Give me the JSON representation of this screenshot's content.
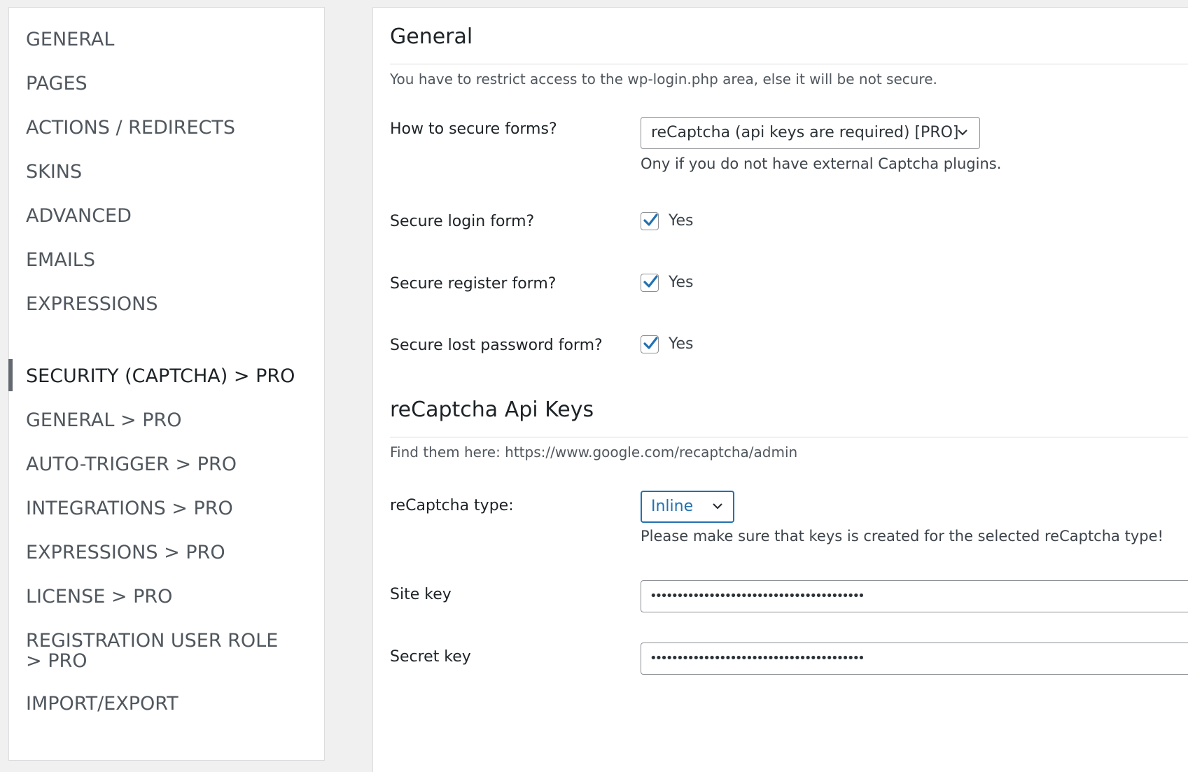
{
  "sidebar": {
    "items": [
      {
        "label": "GENERAL"
      },
      {
        "label": "PAGES"
      },
      {
        "label": "ACTIONS / REDIRECTS"
      },
      {
        "label": "SKINS"
      },
      {
        "label": "ADVANCED"
      },
      {
        "label": "EMAILS"
      },
      {
        "label": "EXPRESSIONS"
      },
      {
        "label": "SECURITY (CAPTCHA) > PRO",
        "active": true
      },
      {
        "label": "GENERAL > PRO"
      },
      {
        "label": "AUTO-TRIGGER > PRO"
      },
      {
        "label": "INTEGRATIONS > PRO"
      },
      {
        "label": "EXPRESSIONS > PRO"
      },
      {
        "label": "LICENSE > PRO"
      },
      {
        "label": "REGISTRATION USER ROLE > PRO"
      },
      {
        "label": "IMPORT/EXPORT"
      }
    ]
  },
  "general": {
    "title": "General",
    "description": "You have to restrict access to the wp-login.php area, else it will be not secure.",
    "secure_forms": {
      "label": "How to secure forms?",
      "value": "reCaptcha (api keys are required) [PRO]",
      "help": "Ony if you do not have external Captcha plugins."
    },
    "secure_login": {
      "label": "Secure login form?",
      "option": "Yes",
      "checked": true
    },
    "secure_register": {
      "label": "Secure register form?",
      "option": "Yes",
      "checked": true
    },
    "secure_lost_password": {
      "label": "Secure lost password form?",
      "option": "Yes",
      "checked": true
    }
  },
  "recaptcha": {
    "title": "reCaptcha Api Keys",
    "description": "Find them here: https://www.google.com/recaptcha/admin",
    "type": {
      "label": "reCaptcha type:",
      "value": "Inline",
      "help": "Please make sure that keys is created for the selected reCaptcha type!"
    },
    "site_key": {
      "label": "Site key",
      "value": "••••••••••••••••••••••••••••••••••••••••"
    },
    "secret_key": {
      "label": "Secret key",
      "value": "••••••••••••••••••••••••••••••••••••••••"
    }
  },
  "colors": {
    "accent": "#2271b1",
    "checkmark": "#2271b1",
    "active_bar": "#646970"
  }
}
